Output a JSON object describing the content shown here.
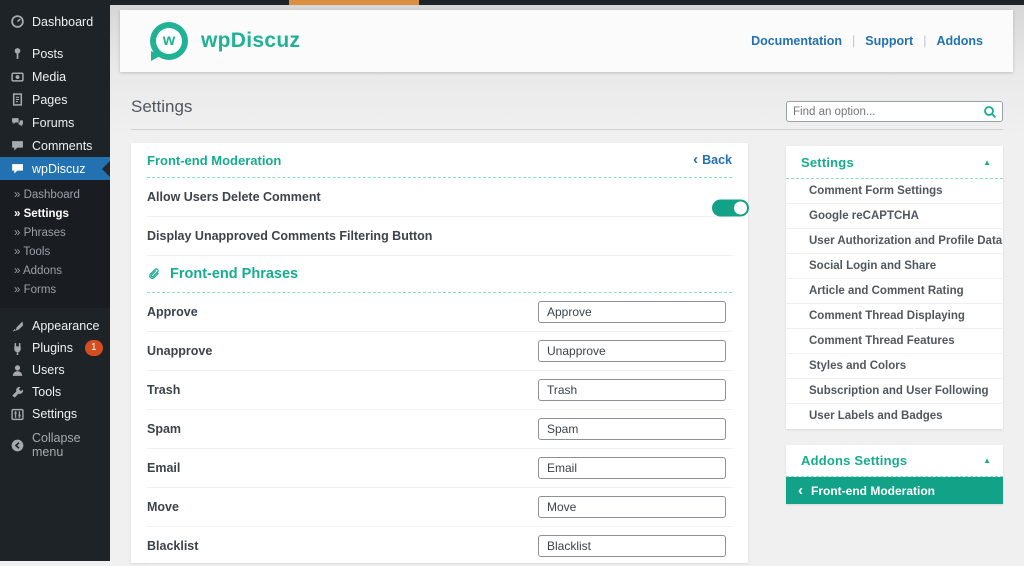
{
  "colors": {
    "accent": "#17ac8f",
    "toggle_on": "#12a287",
    "link_blue": "#2271b1",
    "sidebar_bg": "#1d2327",
    "active_menu_bg": "#2271b1",
    "badge_bg": "#d54e21",
    "admin_strip_orange": "#d98f3d"
  },
  "sidebar": {
    "items": [
      {
        "label": "Dashboard",
        "icon": "dashboard-icon"
      },
      {
        "label": "Posts",
        "icon": "pin-icon"
      },
      {
        "label": "Media",
        "icon": "camera-icon"
      },
      {
        "label": "Pages",
        "icon": "pages-icon"
      },
      {
        "label": "Forums",
        "icon": "forums-icon"
      },
      {
        "label": "Comments",
        "icon": "comment-icon"
      },
      {
        "label": "wpDiscuz",
        "icon": "comment-icon",
        "active": true
      }
    ],
    "submenu": [
      {
        "label": "» Dashboard"
      },
      {
        "label": "» Settings",
        "active": true
      },
      {
        "label": "» Phrases"
      },
      {
        "label": "» Tools"
      },
      {
        "label": "» Addons"
      },
      {
        "label": "» Forms"
      }
    ],
    "lower_items": [
      {
        "label": "Appearance",
        "icon": "brush-icon"
      },
      {
        "label": "Plugins",
        "icon": "plugin-icon",
        "badge": "1"
      },
      {
        "label": "Users",
        "icon": "user-icon"
      },
      {
        "label": "Tools",
        "icon": "wrench-icon"
      },
      {
        "label": "Settings",
        "icon": "sliders-icon"
      }
    ],
    "collapse_label": "Collapse menu"
  },
  "header": {
    "brand": "wpDiscuz",
    "logo_letter": "w",
    "links": [
      {
        "label": "Documentation"
      },
      {
        "label": "Support"
      },
      {
        "label": "Addons"
      }
    ]
  },
  "main": {
    "page_title": "Settings",
    "panel": {
      "title": "Front-end Moderation",
      "back_label": "Back",
      "back_chevron": "‹",
      "toggles": [
        {
          "label": "Allow Users Delete Comment",
          "state": "on"
        },
        {
          "label": "Display Unapproved Comments Filtering Button",
          "state": "on"
        }
      ],
      "section_title": "Front-end Phrases",
      "phrases": [
        {
          "label": "Approve",
          "value": "Approve"
        },
        {
          "label": "Unapprove",
          "value": "Unapprove"
        },
        {
          "label": "Trash",
          "value": "Trash"
        },
        {
          "label": "Spam",
          "value": "Spam"
        },
        {
          "label": "Email",
          "value": "Email"
        },
        {
          "label": "Move",
          "value": "Move"
        },
        {
          "label": "Blacklist",
          "value": "Blacklist"
        }
      ]
    }
  },
  "right": {
    "search_placeholder": "Find an option...",
    "settings_accordion": {
      "title": "Settings",
      "arrow": "▲",
      "items": [
        {
          "label": "Comment Form Settings"
        },
        {
          "label": "Google reCAPTCHA"
        },
        {
          "label": "User Authorization and Profile Data"
        },
        {
          "label": "Social Login and Share"
        },
        {
          "label": "Article and Comment Rating"
        },
        {
          "label": "Comment Thread Displaying"
        },
        {
          "label": "Comment Thread Features"
        },
        {
          "label": "Styles and Colors"
        },
        {
          "label": "Subscription and User Following"
        },
        {
          "label": "User Labels and Badges"
        }
      ]
    },
    "addons_accordion": {
      "title": "Addons Settings",
      "arrow": "▲",
      "active_item": "Front-end Moderation",
      "active_chevron": "‹"
    }
  }
}
